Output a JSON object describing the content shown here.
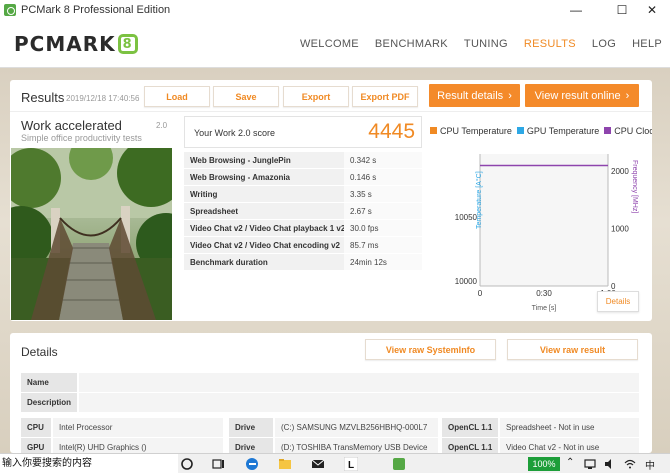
{
  "window": {
    "title": "PCMark 8 Professional Edition",
    "minimize": "—",
    "maximize": "☐",
    "close": "✕"
  },
  "header": {
    "logo": "PCMARK",
    "logo_badge": "8",
    "nav": [
      {
        "label": "WELCOME",
        "active": false
      },
      {
        "label": "BENCHMARK",
        "active": false
      },
      {
        "label": "TUNING",
        "active": false
      },
      {
        "label": "RESULTS",
        "active": true
      },
      {
        "label": "LOG",
        "active": false
      },
      {
        "label": "HELP",
        "active": false
      }
    ]
  },
  "results": {
    "title": "Results",
    "date": "2019/12/18 17:40:56",
    "load": "Load",
    "save": "Save",
    "export": "Export",
    "export_pdf": "Export PDF",
    "result_details": "Result details",
    "view_online": "View result online"
  },
  "workload": {
    "title": "Work accelerated",
    "version": "2.0",
    "subtitle": "Simple office productivity tests",
    "score_label": "Your Work 2.0 score",
    "score": "4445",
    "subtests": [
      {
        "name": "Web Browsing - JunglePin",
        "value": "0.342 s"
      },
      {
        "name": "Web Browsing - Amazonia",
        "value": "0.146 s"
      },
      {
        "name": "Writing",
        "value": "3.35 s"
      },
      {
        "name": "Spreadsheet",
        "value": "2.67 s"
      },
      {
        "name": "Video Chat v2 / Video Chat playback 1 v2",
        "value": "30.0 fps"
      },
      {
        "name": "Video Chat v2 / Video Chat encoding v2",
        "value": "85.7 ms"
      },
      {
        "name": "Benchmark duration",
        "value": "24min 12s"
      }
    ]
  },
  "chart_data": {
    "type": "line",
    "legend": [
      "CPU Temperature",
      "GPU Temperature",
      "CPU Clock"
    ],
    "legend_colors": [
      "#f08a24",
      "#2ea8e5",
      "#8e44ad"
    ],
    "xlabel": "Time [s]",
    "ylabel_left": "Temperature [A°C]",
    "ylabel_right": "Frequency [MHz]",
    "x_ticks": [
      "0",
      "0:30",
      "1:00"
    ],
    "y_left_ticks": [
      "10050",
      "10000"
    ],
    "y_right_ticks": [
      "2000",
      "1000",
      "0"
    ],
    "y_right_lim": [
      0,
      2300
    ],
    "x_lim": [
      0,
      60
    ],
    "series": [
      {
        "name": "CPU Clock",
        "x": [
          0,
          60
        ],
        "y": [
          2100,
          2100
        ]
      }
    ],
    "details_label": "Details"
  },
  "details": {
    "title": "Details",
    "raw_sysinfo": "View raw SystemInfo",
    "raw_result": "View raw result",
    "name_label": "Name",
    "description_label": "Description",
    "cpu_label": "CPU",
    "cpu_value": "Intel Processor",
    "gpu_label": "GPU",
    "gpu_value": "Intel(R) UHD Graphics ()",
    "drive1_label": "Drive",
    "drive1_value": "(C:) SAMSUNG MZVLB256HBHQ-000L7",
    "drive2_label": "Drive",
    "drive2_value": "(D:) TOSHIBA TransMemory USB Device",
    "opencl1_label": "OpenCL 1.1",
    "opencl1_value": "Spreadsheet - Not in use",
    "opencl2_label": "OpenCL 1.1",
    "opencl2_value": "Video Chat v2 - Not in use"
  },
  "taskbar": {
    "search": "输入你要搜索的内容",
    "battery": "100%",
    "ime": "中"
  }
}
